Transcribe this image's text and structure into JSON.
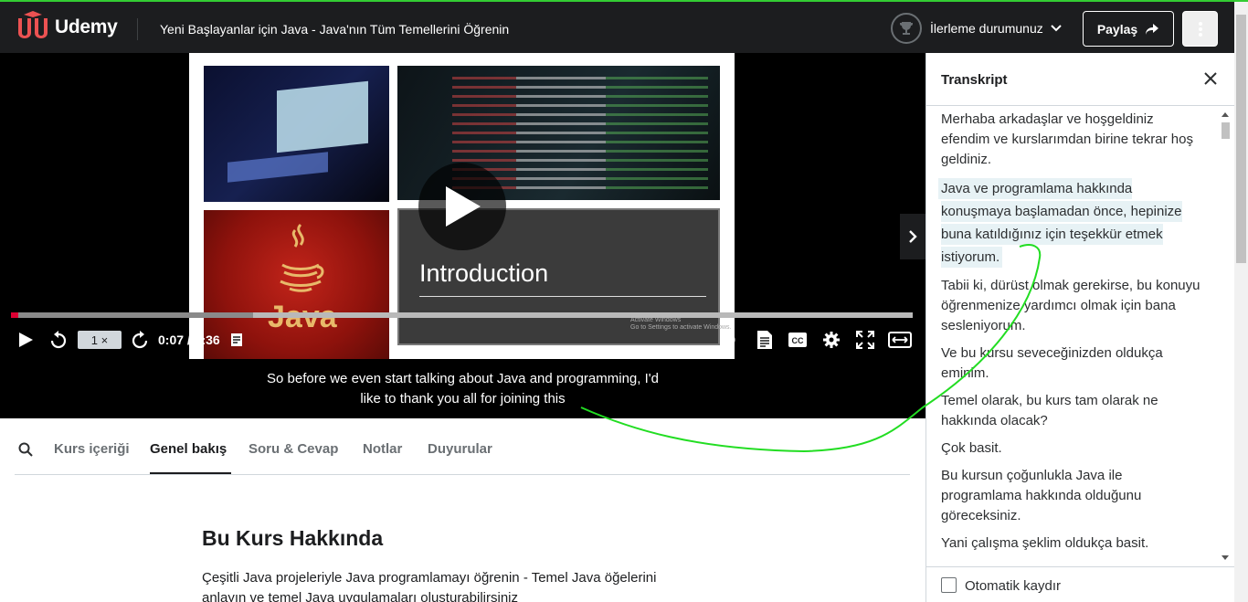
{
  "header": {
    "brand": "Udemy",
    "course_title": "Yeni Başlayanlar için Java - Java'nın Tüm Temellerini Öğrenin",
    "progress_label": "İlerleme durumunuz",
    "share_label": "Paylaş",
    "icons": [
      "udemy-logo",
      "trophy-icon",
      "chevron-down-icon",
      "share-arrow-icon",
      "kebab-menu-icon"
    ]
  },
  "player": {
    "slide_heading": "Introduction",
    "slide_java_label": "Java",
    "watermark_line1": "Activate Windows",
    "watermark_line2": "Go to Settings to activate Windows.",
    "playback_rate": "1 ×",
    "time": "0:07 / 8:36",
    "progress_fraction": 0.014,
    "caption_line1": "So before we even start talking about Java and programming, I'd",
    "caption_line2": "like to thank you all for joining this"
  },
  "tabs": {
    "items": [
      "Kurs içeriği",
      "Genel bakış",
      "Soru & Cevap",
      "Notlar",
      "Duyurular"
    ],
    "active": "Genel bakış"
  },
  "about": {
    "title": "Bu Kurs Hakkında",
    "description": "Çeşitli Java projeleriyle Java programlamayı öğrenin - Temel Java öğelerini anlayın ve temel Java uygulamaları oluşturabilirsiniz"
  },
  "transcript": {
    "title": "Transkript",
    "cues": [
      "Merhaba arkadaşlar ve hoşgeldiniz efendim ve kurslarımdan birine tekrar hoş geldiniz.",
      "Java ve programlama hakkında konuşmaya başlamadan önce, hepinize buna katıldığınız için teşekkür etmek istiyorum.",
      "Tabii ki, dürüst olmak gerekirse, bu konuyu öğrenmenize yardımcı olmak için bana sesleniyorum.",
      "Ve bu kursu seveceğinizden oldukça eminim.",
      "Temel olarak, bu kurs tam olarak ne hakkında olacak?",
      "Çok basit.",
      "Bu kursun çoğunlukla Java ile programlama hakkında olduğunu göreceksiniz.",
      "Yani çalışma şeklim oldukça basit."
    ],
    "active_cue": 1,
    "autoscroll_label": "Otomatik kaydır"
  },
  "colors": {
    "header_bg": "#1c1d1f",
    "brand_red": "#a435f0",
    "progress_red": "#d03",
    "highlight": "#e7f2f5",
    "annotation_green": "#22dd22"
  }
}
